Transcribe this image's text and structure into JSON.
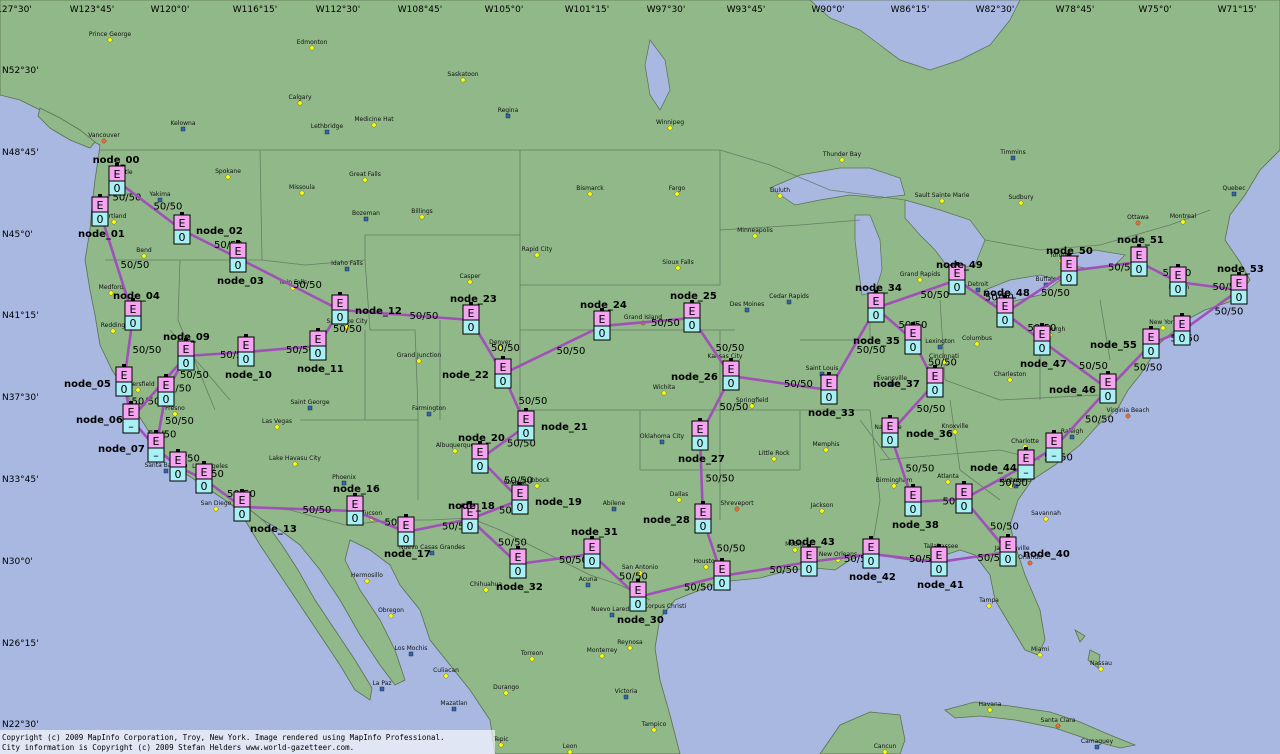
{
  "longitude_labels": [
    "127°30'",
    "W123°45'",
    "W120°0'",
    "W116°15'",
    "W112°30'",
    "W108°45'",
    "W105°0'",
    "W101°15'",
    "W97°30'",
    "W93°45'",
    "W90°0'",
    "W86°15'",
    "W82°30'",
    "W78°45'",
    "W75°0'",
    "W71°15'"
  ],
  "latitude_labels": [
    "N52°30'",
    "N48°45'",
    "N45°0'",
    "N41°15'",
    "N37°30'",
    "N33°45'",
    "N30°0'",
    "N26°15'",
    "N22°30'"
  ],
  "cities": [
    "Prince George",
    "Edmonton",
    "Saskatoon",
    "Calgary",
    "Medicine Hat",
    "Regina",
    "Kelowna",
    "Lethbridge",
    "Winnipeg",
    "Vancouver",
    "Spokane",
    "Great Falls",
    "Missoula",
    "Thunder Bay",
    "Timmins",
    "Bismarck",
    "Fargo",
    "Duluth",
    "Sault Sainte Marie",
    "Sudbury",
    "Quebec",
    "Yakima",
    "Bozeman",
    "Billings",
    "Ottawa",
    "Montreal",
    "Bend",
    "Rapid City",
    "Minneapolis",
    "Idaho Falls",
    "Twin Falls",
    "Sioux Falls",
    "Grand Rapids",
    "Casper",
    "Medford",
    "Des Moines",
    "Cedar Rapids",
    "Detroit",
    "Toronto",
    "Grand Island",
    "Columbus",
    "Denver",
    "Kansas City",
    "Grand Junction",
    "Saint Louis",
    "Cincinnati",
    "Charleston",
    "Wichita",
    "Springfield",
    "Fresno",
    "Saint George",
    "Farmington",
    "Oklahoma City",
    "Knoxville",
    "Virginia Beach",
    "Las Vegas",
    "Memphis",
    "Little Rock",
    "Charlotte",
    "Raleigh",
    "Albuquerque",
    "Lake Havasu City",
    "Lubbock",
    "Atlanta",
    "Augusta",
    "Richmond",
    "Phoenix",
    "Abilene",
    "Dallas",
    "Shreveport",
    "Birmingham",
    "Jackson",
    "Savannah",
    "Tucson",
    "Nuevo Casas Grandes",
    "San Antonio",
    "Houston",
    "Tallahassee",
    "Jacksonville",
    "Chihuahua",
    "Acuna",
    "Corpus Christi",
    "Nuevo Laredo",
    "Hermosillo",
    "Orlando",
    "Tampa",
    "Obregon",
    "Monterrey",
    "Torreon",
    "Los Mochis",
    "Reynosa",
    "Miami",
    "Nassau",
    "Culiacan",
    "Durango",
    "La Paz",
    "Victoria",
    "Mazatlan",
    "Havana",
    "Santa Clara",
    "Tampico",
    "Tepic",
    "Leon",
    "Cancun",
    "Camaguey",
    "Portland",
    "Seattle",
    "Redding",
    "Salt Lake City",
    "Roswell",
    "Evansville",
    "Lexington",
    "Buffalo",
    "New York",
    "Boston",
    "Pittsburgh",
    "Nashville",
    "Mobile",
    "New Orleans",
    "Santa Barbara",
    "Los Angeles",
    "San Diego",
    "Bakersfield"
  ],
  "nodes": [
    {
      "id": "node_00",
      "top": "E",
      "bottom": "0"
    },
    {
      "id": "node_01",
      "top": "E",
      "bottom": "0"
    },
    {
      "id": "node_02",
      "top": "E",
      "bottom": "0"
    },
    {
      "id": "node_03",
      "top": "E",
      "bottom": "0"
    },
    {
      "id": "node_04",
      "top": "E",
      "bottom": "0"
    },
    {
      "id": "node_05",
      "top": "E",
      "bottom": "0"
    },
    {
      "id": "node_06",
      "top": "E",
      "bottom": "–"
    },
    {
      "id": "node_07",
      "top": "E",
      "bottom": "–"
    },
    {
      "id": "node_08",
      "top": "E",
      "bottom": "0"
    },
    {
      "id": "node_09",
      "top": "E",
      "bottom": "0"
    },
    {
      "id": "node_10",
      "top": "E",
      "bottom": "0"
    },
    {
      "id": "node_11",
      "top": "E",
      "bottom": "0"
    },
    {
      "id": "node_12",
      "top": "E",
      "bottom": "0"
    },
    {
      "id": "node_13",
      "top": "E",
      "bottom": "0"
    },
    {
      "id": "node_14",
      "top": "E",
      "bottom": "0"
    },
    {
      "id": "node_15",
      "top": "E",
      "bottom": "0"
    },
    {
      "id": "node_16",
      "top": "E",
      "bottom": "0"
    },
    {
      "id": "node_17",
      "top": "E",
      "bottom": "0"
    },
    {
      "id": "node_18",
      "top": "E",
      "bottom": "0"
    },
    {
      "id": "node_19",
      "top": "E",
      "bottom": "0"
    },
    {
      "id": "node_20",
      "top": "E",
      "bottom": "0"
    },
    {
      "id": "node_21",
      "top": "E",
      "bottom": "0"
    },
    {
      "id": "node_22",
      "top": "E",
      "bottom": "0"
    },
    {
      "id": "node_23",
      "top": "E",
      "bottom": "0"
    },
    {
      "id": "node_24",
      "top": "E",
      "bottom": "0"
    },
    {
      "id": "node_25",
      "top": "E",
      "bottom": "0"
    },
    {
      "id": "node_26",
      "top": "E",
      "bottom": "0"
    },
    {
      "id": "node_27",
      "top": "E",
      "bottom": "0"
    },
    {
      "id": "node_28",
      "top": "E",
      "bottom": "0"
    },
    {
      "id": "node_29",
      "top": "E",
      "bottom": "0"
    },
    {
      "id": "node_30",
      "top": "E",
      "bottom": "0"
    },
    {
      "id": "node_31",
      "top": "E",
      "bottom": "0"
    },
    {
      "id": "node_32",
      "top": "E",
      "bottom": "0"
    },
    {
      "id": "node_33",
      "top": "E",
      "bottom": "0"
    },
    {
      "id": "node_34",
      "top": "E",
      "bottom": "0"
    },
    {
      "id": "node_35",
      "top": "E",
      "bottom": "0"
    },
    {
      "id": "node_36",
      "top": "E",
      "bottom": "0"
    },
    {
      "id": "node_37",
      "top": "E",
      "bottom": "0"
    },
    {
      "id": "node_38",
      "top": "E",
      "bottom": "0"
    },
    {
      "id": "node_39",
      "top": "E",
      "bottom": "0"
    },
    {
      "id": "node_40",
      "top": "E",
      "bottom": "0"
    },
    {
      "id": "node_41",
      "top": "E",
      "bottom": "0"
    },
    {
      "id": "node_42",
      "top": "E",
      "bottom": "0"
    },
    {
      "id": "node_43",
      "top": "E",
      "bottom": "0"
    },
    {
      "id": "node_44",
      "top": "E",
      "bottom": "–"
    },
    {
      "id": "node_45",
      "top": "E",
      "bottom": "–"
    },
    {
      "id": "node_46",
      "top": "E",
      "bottom": "0"
    },
    {
      "id": "node_47",
      "top": "E",
      "bottom": "0"
    },
    {
      "id": "node_48",
      "top": "E",
      "bottom": "0"
    },
    {
      "id": "node_49",
      "top": "E",
      "bottom": "0"
    },
    {
      "id": "node_50",
      "top": "E",
      "bottom": "0"
    },
    {
      "id": "node_51",
      "top": "E",
      "bottom": "0"
    },
    {
      "id": "node_52",
      "top": "E",
      "bottom": "0"
    },
    {
      "id": "node_53",
      "top": "E",
      "bottom": "0"
    },
    {
      "id": "node_54",
      "top": "E",
      "bottom": "0"
    },
    {
      "id": "node_55",
      "top": "E",
      "bottom": "0"
    }
  ],
  "hidden_node_labels": [
    "node_08",
    "node_14",
    "node_15",
    "node_29",
    "node_39",
    "node_45",
    "node_52",
    "node_54"
  ],
  "links": [
    [
      "node_00",
      "node_01"
    ],
    [
      "node_00",
      "node_02"
    ],
    [
      "node_02",
      "node_03"
    ],
    [
      "node_03",
      "node_12"
    ],
    [
      "node_01",
      "node_04"
    ],
    [
      "node_04",
      "node_05"
    ],
    [
      "node_05",
      "node_06"
    ],
    [
      "node_06",
      "node_07"
    ],
    [
      "node_07",
      "node_08"
    ],
    [
      "node_08",
      "node_09"
    ],
    [
      "node_09",
      "node_10"
    ],
    [
      "node_10",
      "node_11"
    ],
    [
      "node_11",
      "node_12"
    ],
    [
      "node_12",
      "node_23"
    ],
    [
      "node_07",
      "node_14"
    ],
    [
      "node_14",
      "node_15"
    ],
    [
      "node_15",
      "node_13"
    ],
    [
      "node_13",
      "node_16"
    ],
    [
      "node_16",
      "node_17"
    ],
    [
      "node_17",
      "node_18"
    ],
    [
      "node_18",
      "node_19"
    ],
    [
      "node_18",
      "node_32"
    ],
    [
      "node_19",
      "node_20"
    ],
    [
      "node_20",
      "node_21"
    ],
    [
      "node_21",
      "node_22"
    ],
    [
      "node_22",
      "node_23"
    ],
    [
      "node_22",
      "node_24"
    ],
    [
      "node_24",
      "node_25"
    ],
    [
      "node_25",
      "node_26"
    ],
    [
      "node_26",
      "node_27"
    ],
    [
      "node_27",
      "node_28"
    ],
    [
      "node_28",
      "node_29"
    ],
    [
      "node_26",
      "node_33"
    ],
    [
      "node_32",
      "node_31"
    ],
    [
      "node_31",
      "node_30"
    ],
    [
      "node_30",
      "node_29"
    ],
    [
      "node_29",
      "node_43"
    ],
    [
      "node_43",
      "node_42"
    ],
    [
      "node_42",
      "node_41"
    ],
    [
      "node_41",
      "node_40"
    ],
    [
      "node_40",
      "node_39"
    ],
    [
      "node_39",
      "node_38"
    ],
    [
      "node_38",
      "node_36"
    ],
    [
      "node_36",
      "node_37"
    ],
    [
      "node_37",
      "node_35"
    ],
    [
      "node_35",
      "node_34"
    ],
    [
      "node_34",
      "node_33"
    ],
    [
      "node_34",
      "node_49"
    ],
    [
      "node_49",
      "node_48"
    ],
    [
      "node_48",
      "node_50"
    ],
    [
      "node_50",
      "node_51"
    ],
    [
      "node_51",
      "node_52"
    ],
    [
      "node_52",
      "node_53"
    ],
    [
      "node_53",
      "node_54"
    ],
    [
      "node_54",
      "node_55"
    ],
    [
      "node_55",
      "node_46"
    ],
    [
      "node_46",
      "node_47"
    ],
    [
      "node_47",
      "node_48"
    ],
    [
      "node_46",
      "node_45"
    ],
    [
      "node_45",
      "node_44"
    ],
    [
      "node_44",
      "node_39"
    ],
    [
      "node_09",
      "node_06"
    ]
  ],
  "link_label": "50/50",
  "copyright_line1": "Copyright (c) 2009 MapInfo Corporation, Troy, New York. Image rendered using MapInfo Professional.",
  "copyright_line2": "City information is Copyright (c) 2009 Stefan Helders www.world-gazetteer.com.",
  "colors": {
    "ocean": "#a8b8e0",
    "land": "#90b888",
    "lake": "#a8b8e0",
    "border": "#607860",
    "link": "#a050b8",
    "node_top": "#f4a4f0",
    "node_bottom": "#a8f0f4"
  }
}
